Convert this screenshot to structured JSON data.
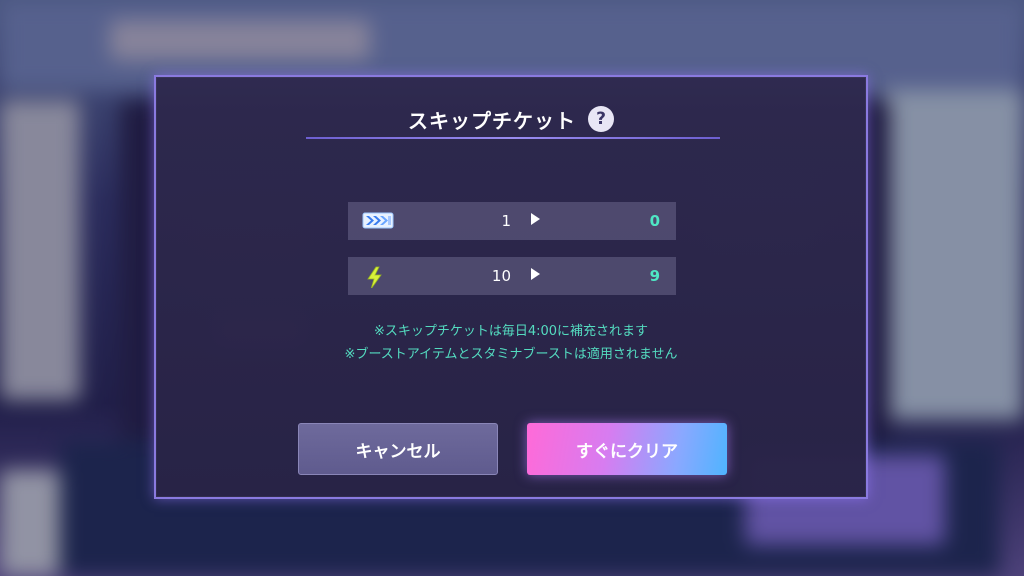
{
  "dialog": {
    "title": "スキップチケット",
    "help_label": "?",
    "rows": [
      {
        "icon": "skip-ticket-icon",
        "before": "1",
        "after": "0"
      },
      {
        "icon": "lightning-stamina-icon",
        "before": "10",
        "after": "9"
      }
    ],
    "notes": [
      "※スキップチケットは毎日4:00に補充されます",
      "※ブーストアイテムとスタミナブーストは適用されません"
    ],
    "cancel_label": "キャンセル",
    "clear_label": "すぐにクリア"
  },
  "colors": {
    "accent_border": "#8a7ae0",
    "result_value": "#4fe6c4",
    "note_text": "#54dcc0"
  }
}
